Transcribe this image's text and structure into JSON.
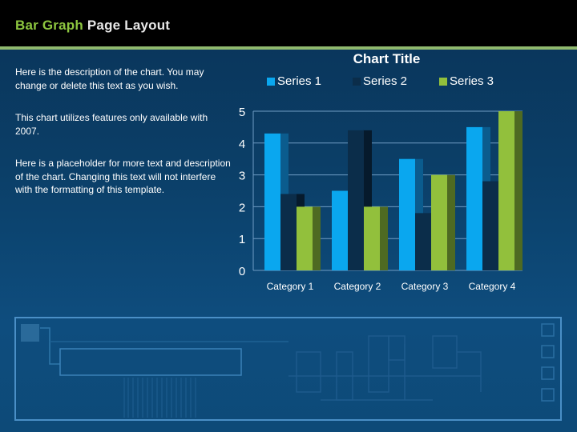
{
  "header": {
    "title_part1": "Bar Graph",
    "title_part2": "Page Layout"
  },
  "description": {
    "paragraph1": "Here is the description of the chart.  You may change or delete this text as you wish.",
    "paragraph2": "This chart utilizes features only available with 2007.",
    "paragraph3": "Here is a placeholder for more text and description of the chart.  Changing this text will not interfere with the formatting of this template."
  },
  "colors": {
    "accent_green": "#8dc63f",
    "header_bg": "#000000",
    "rule": "#8fb86e"
  },
  "chart_data": {
    "type": "bar",
    "title": "Chart Title",
    "xlabel": "",
    "ylabel": "",
    "categories": [
      "Category 1",
      "Category 2",
      "Category 3",
      "Category 4"
    ],
    "series": [
      {
        "name": "Series 1",
        "values": [
          4.3,
          2.5,
          3.5,
          4.5
        ],
        "color": "#0aa7ef",
        "side_color": "#0b5c8e"
      },
      {
        "name": "Series 2",
        "values": [
          2.4,
          4.4,
          1.8,
          2.8
        ],
        "color": "#0b2d4a",
        "side_color": "#061a2c"
      },
      {
        "name": "Series 3",
        "values": [
          2.0,
          2.0,
          3.0,
          5.0
        ],
        "color": "#92c03c",
        "side_color": "#4e6a22"
      }
    ],
    "ylim": [
      0,
      5
    ],
    "yticks": [
      0,
      1,
      2,
      3,
      4,
      5
    ],
    "grid": true,
    "legend": "top",
    "style": "3d-clustered"
  }
}
